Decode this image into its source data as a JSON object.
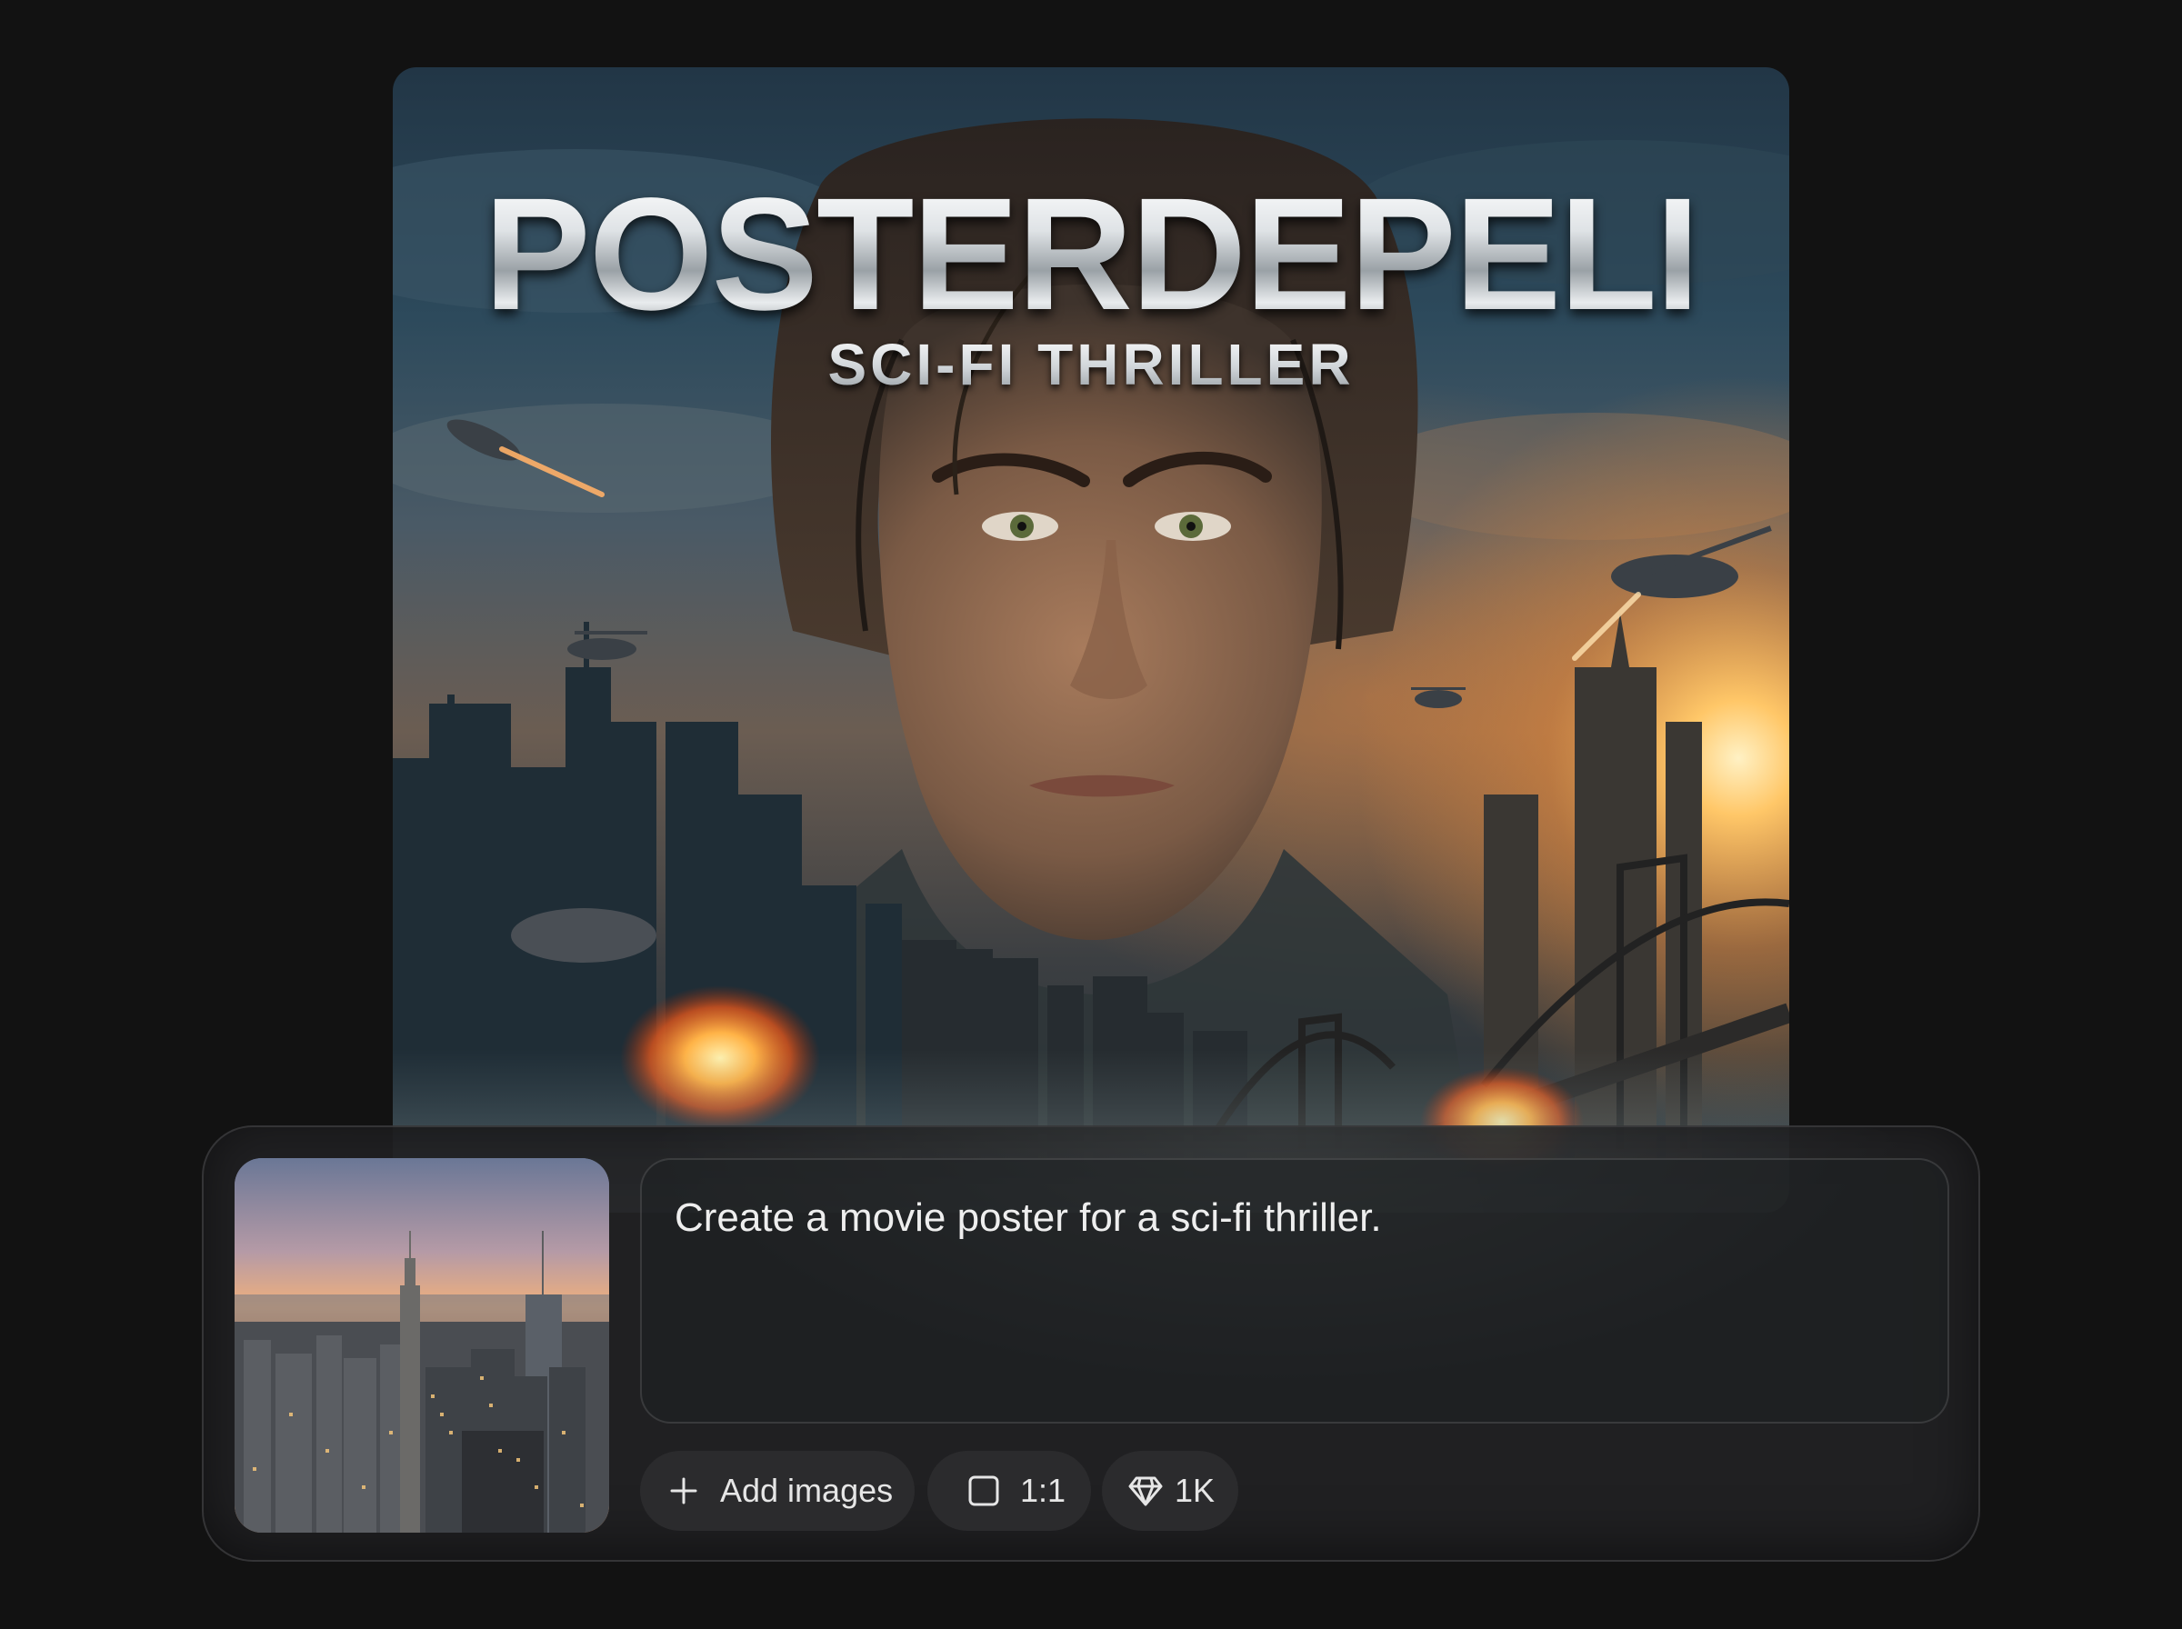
{
  "poster": {
    "title": "POSTERDEPELI",
    "subtitle": "SCI-FI THRILLER"
  },
  "composer": {
    "prompt": "Create a movie poster for a sci-fi thriller.",
    "add_images_label": "Add images",
    "aspect_ratio": "1:1",
    "resolution": "1K"
  },
  "icons": {
    "add": "plus-icon",
    "ratio": "square-icon",
    "resolution": "gem-icon"
  },
  "colors": {
    "background": "#121212",
    "composer_bg": "#222224",
    "chip_bg": "#2b2b2d",
    "text": "#eeeeee"
  }
}
